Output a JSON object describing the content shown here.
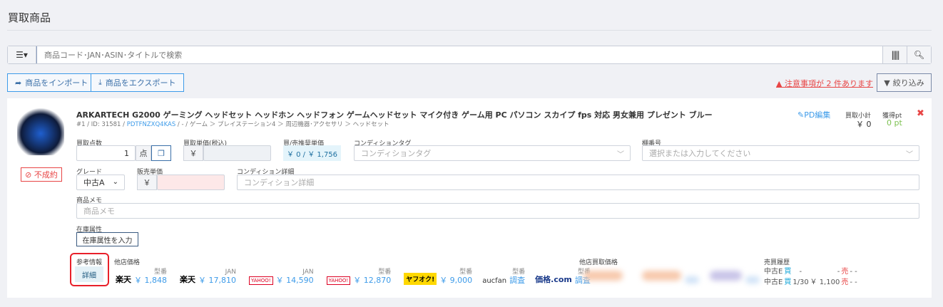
{
  "page_title": "買取商品",
  "search": {
    "placeholder": "商品コード･JAN･ASIN･タイトルで検索"
  },
  "toolbar": {
    "import_label": "商品をインポート",
    "export_label": "商品をエクスポート",
    "warning": "注意事項が 2 件あります",
    "filter_label": "絞り込み"
  },
  "item": {
    "title": "ARKARTECH G2000 ゲーミング ヘッドセット ヘッドホン ヘッドフォン ゲームヘッドセット マイク付き ゲーム用 PC パソコン スカイプ fps 対応 男女兼用 プレゼント ブルー",
    "meta_prefix": "#1 / ID: 31581 / ",
    "code": "PDTFNZXQ4KAS",
    "meta_suffix": " / - / ゲーム ＞ プレイステーション4 ＞ 周辺機器･アクセサリ ＞ ヘッドセット",
    "status_badge": "不成約",
    "pd_edit": "PD編集",
    "subtotal_label": "買取小計",
    "subtotal": "￥ 0",
    "points_label": "獲得pt",
    "points": "0 pt",
    "qty_label": "買取点数",
    "qty": "1",
    "qty_unit": "点",
    "buy_price_label": "買取単価(税込)",
    "yen": "￥",
    "recommend_label": "買/売推奨単価",
    "recommend": "￥ 0 / ￥ 1,756",
    "cond_tag_label": "コンディションタグ",
    "cond_tag_placeholder": "コンディションタグ",
    "shelf_label": "棚番号",
    "shelf_placeholder": "選択または入力してください",
    "grade_label": "グレード",
    "grade": "中古A",
    "sale_price_label": "販売単価",
    "cond_detail_label": "コンディション詳細",
    "cond_detail_placeholder": "コンディション詳細",
    "memo_label": "商品メモ",
    "memo_placeholder": "商品メモ",
    "stock_attr_label": "在庫属性",
    "stock_attr_button": "在庫属性を入力",
    "ref_label": "参考情報",
    "ref_button": "詳細",
    "other_prices_label": "他店価格",
    "stores": [
      {
        "logo": "楽天",
        "type": "型番",
        "value": "￥ 1,848"
      },
      {
        "logo": "楽天",
        "type": "JAN",
        "value": "￥ 17,810"
      },
      {
        "logo": "YAHOO!",
        "type": "JAN",
        "value": "￥ 14,590"
      },
      {
        "logo": "YAHOO!",
        "type": "型番",
        "value": "￥ 12,870"
      },
      {
        "logo": "ヤフオク!",
        "type": "型番",
        "value": "￥ 9,000"
      },
      {
        "logo": "aucfan",
        "type": "型番",
        "value": "調査"
      },
      {
        "logo": "価格.com",
        "type": "型番",
        "value": "調査"
      }
    ],
    "other_buy_label": "他店買取価格",
    "history_label": "売買履歴",
    "history": [
      {
        "grade": "中古E",
        "buy": "買",
        "buy_val": "-",
        "buy_price": "-",
        "sell": "売",
        "sell_val": "- -"
      },
      {
        "grade": "中古E",
        "buy": "買",
        "buy_val": "1/30",
        "buy_price": "￥ 1,100",
        "sell": "売",
        "sell_val": "- -"
      }
    ]
  }
}
